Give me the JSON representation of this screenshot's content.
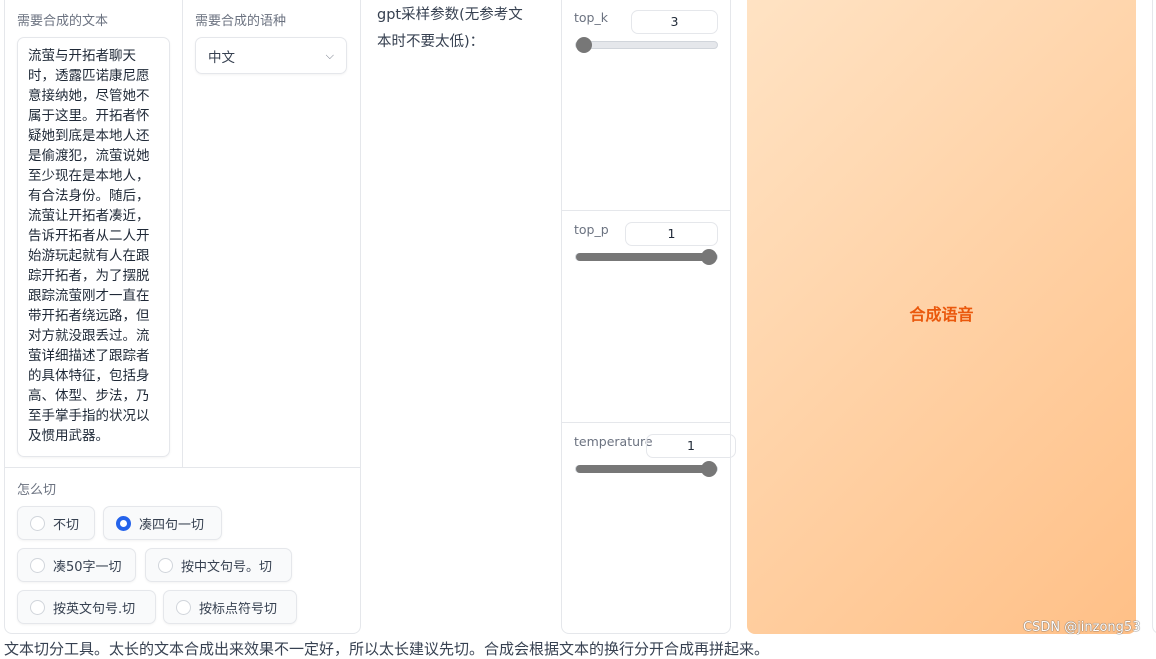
{
  "text_input": {
    "label": "需要合成的文本",
    "value": "流萤与开拓者聊天时，透露匹诺康尼愿意接纳她，尽管她不属于这里。开拓者怀疑她到底是本地人还是偷渡犯，流萤说她至少现在是本地人，有合法身份。随后，流萤让开拓者凑近，告诉开拓者从二人开始游玩起就有人在跟踪开拓者，为了摆脱跟踪流萤刚才一直在带开拓者绕远路，但对方就没跟丢过。流萤详细描述了跟踪者的具体特征，包括身高、体型、步法，乃至手掌手指的状况以及惯用武器。"
  },
  "language": {
    "label": "需要合成的语种",
    "value": "中文"
  },
  "split": {
    "label": "怎么切",
    "options": [
      "不切",
      "凑四句一切",
      "凑50字一切",
      "按中文句号。切",
      "按英文句号.切",
      "按标点符号切"
    ],
    "selected": "凑四句一切"
  },
  "gpt_params_label": "gpt采样参数(无参考文本时不要太低)：",
  "sliders": [
    {
      "label": "top_k",
      "value": "3",
      "fraction": 0.0
    },
    {
      "label": "top_p",
      "value": "1",
      "fraction": 1.0
    },
    {
      "label": "temperature",
      "value": "1",
      "fraction": 1.0
    }
  ],
  "synthesize_button": "合成语音",
  "footer_text": "文本切分工具。太长的文本合成出来效果不一定好，所以太长建议先切。合成会根据文本的换行分开合成再拼起来。",
  "watermark": "CSDN @jinzong53",
  "colors": {
    "accent": "#2563eb",
    "button_text": "#ea580c",
    "button_from": "#ffe3c4",
    "button_to": "#ffc087"
  }
}
